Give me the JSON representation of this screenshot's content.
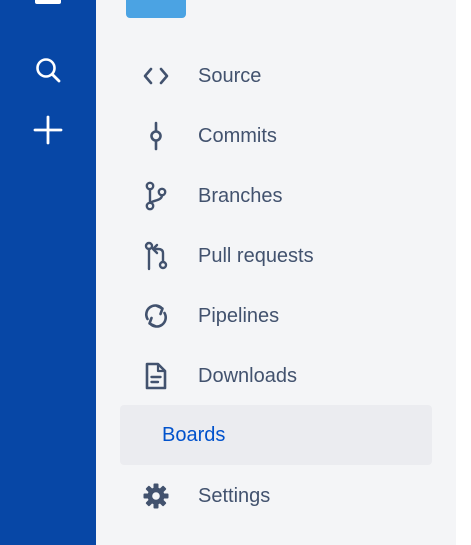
{
  "colors": {
    "global_nav_bg": "#0747a6",
    "sidebar_bg": "#f4f5f7",
    "active_item_bg": "#ebecf0",
    "active_text": "#0052cc",
    "text": "#42526e",
    "repo_avatar": "#4ba3e3"
  },
  "global_nav": {
    "items": [
      {
        "name": "search",
        "icon": "search-icon"
      },
      {
        "name": "create",
        "icon": "plus-icon"
      }
    ]
  },
  "sidebar": {
    "items": [
      {
        "label": "Source",
        "icon": "code-icon"
      },
      {
        "label": "Commits",
        "icon": "commit-icon"
      },
      {
        "label": "Branches",
        "icon": "branch-icon"
      },
      {
        "label": "Pull requests",
        "icon": "pull-request-icon"
      },
      {
        "label": "Pipelines",
        "icon": "pipelines-icon"
      },
      {
        "label": "Downloads",
        "icon": "document-icon"
      },
      {
        "label": "Boards",
        "active": true
      },
      {
        "label": "Settings",
        "icon": "gear-icon"
      }
    ]
  }
}
